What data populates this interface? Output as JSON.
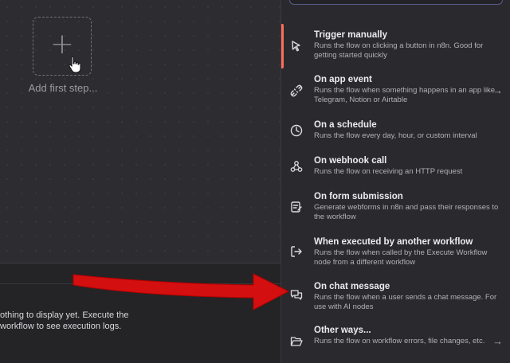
{
  "canvas": {
    "add_step_label": "Add first step...",
    "plus_symbol": "+"
  },
  "logs": {
    "empty_message": "othing to display yet. Execute the\nworkflow to see execution logs."
  },
  "triggers": [
    {
      "title": "Trigger manually",
      "description": "Runs the flow on clicking a button in n8n. Good for getting started quickly",
      "icon": "cursor-click-icon",
      "has_chevron": false
    },
    {
      "title": "On app event",
      "description": "Runs the flow when something happens in an app like Telegram, Notion or Airtable",
      "icon": "app-event-icon",
      "has_chevron": true
    },
    {
      "title": "On a schedule",
      "description": "Runs the flow every day, hour, or custom interval",
      "icon": "clock-icon",
      "has_chevron": false
    },
    {
      "title": "On webhook call",
      "description": "Runs the flow on receiving an HTTP request",
      "icon": "webhook-icon",
      "has_chevron": false
    },
    {
      "title": "On form submission",
      "description": "Generate webforms in n8n and pass their responses to the workflow",
      "icon": "form-icon",
      "has_chevron": false
    },
    {
      "title": "When executed by another workflow",
      "description": "Runs the flow when called by the Execute Workflow node from a different workflow",
      "icon": "sign-in-icon",
      "has_chevron": false
    },
    {
      "title": "On chat message",
      "description": "Runs the flow when a user sends a chat message. For use with AI nodes",
      "icon": "chat-icon",
      "has_chevron": false
    },
    {
      "title": "Other ways...",
      "description": "Runs the flow on workflow errors, file changes, etc.",
      "icon": "folder-open-icon",
      "has_chevron": true
    }
  ],
  "colors": {
    "accent": "#ff6d5a",
    "annotation_arrow": "#d40f0f"
  }
}
